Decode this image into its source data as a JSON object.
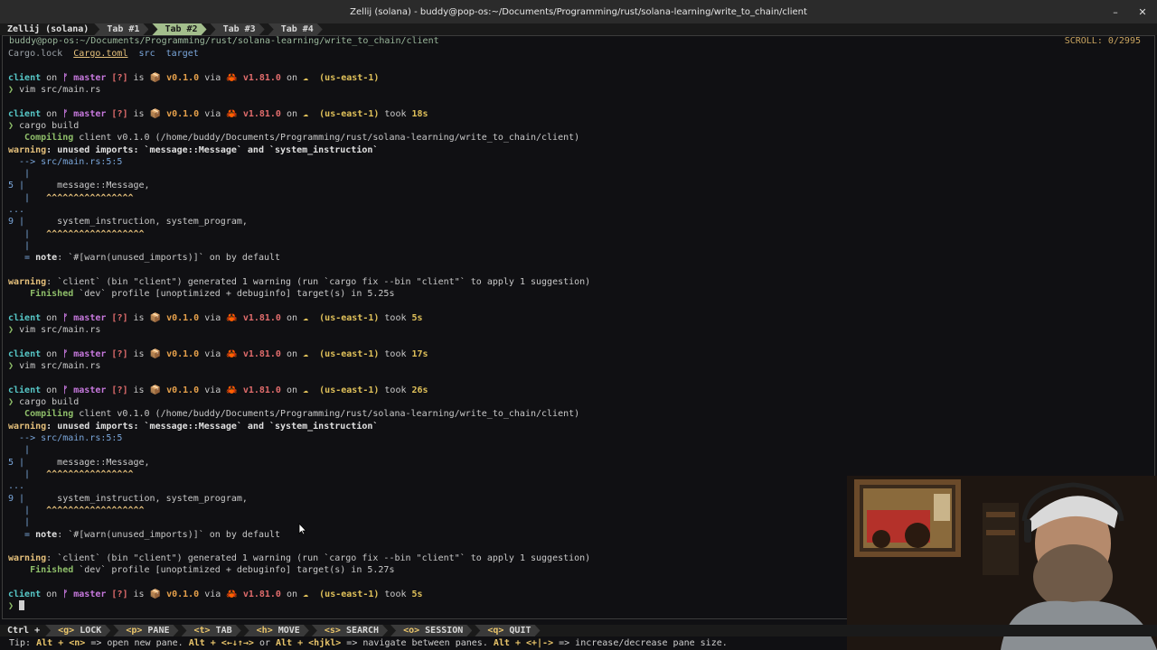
{
  "window": {
    "title": "Zellij (solana) - buddy@pop-os:~/Documents/Programming/rust/solana-learning/write_to_chain/client"
  },
  "tabbar": {
    "session": "Zellij (solana)",
    "tabs": [
      {
        "label": "Tab #1"
      },
      {
        "label": "Tab #2"
      },
      {
        "label": "Tab #3"
      },
      {
        "label": "Tab #4"
      }
    ]
  },
  "pane": {
    "title": "buddy@pop-os:~/Documents/Programming/rust/solana-learning/write_to_chain/client",
    "scroll": "SCROLL:  0/2995"
  },
  "terminal": {
    "ls": {
      "f1": "Cargo.lock",
      "f2": "Cargo.toml",
      "d1": "src",
      "d2": "target"
    },
    "prompt_parts": {
      "dir": "client",
      "on": "on",
      "branch_icon": "ᚠ",
      "branch": "master",
      "status": "[?]",
      "is": "is",
      "pkg_icon": "📦",
      "pkg_ver": "v0.1.0",
      "via": "via",
      "rust_icon": "🦀",
      "rust_ver": "v1.81.0",
      "aws_icon": "☁",
      "region": "(us-east-1)",
      "took": "took"
    },
    "durations": [
      "",
      "18s",
      "5s",
      "17s",
      "26s",
      "5s"
    ],
    "cmd_prefix": "❯",
    "cmds": {
      "vim": "vim src/main.rs",
      "build": "cargo build"
    },
    "compiling": "   Compiling client v0.1.0 (/home/buddy/Documents/Programming/rust/solana-learning/write_to_chain/client)",
    "warning_label": "warning",
    "unused": ": unused imports: `message::Message` and `system_instruction`",
    "arrow_line": "  --> src/main.rs:5:5",
    "pipe": "   |",
    "l5_num": "5 |",
    "l5_code": "      message::Message,",
    "l5_caret": "      ^^^^^^^^^^^^^^^^",
    "dots": "...",
    "l9_num": "9 |",
    "l9_code": "      system_instruction, system_program,",
    "l9_caret": "      ^^^^^^^^^^^^^^^^^^",
    "note_prefix": "   = ",
    "note_label": "note",
    "note_text": ": `#[warn(unused_imports)]` on by default",
    "gen_warning": ": `client` (bin \"client\") generated 1 warning (run `cargo fix --bin \"client\"` to apply 1 suggestion)",
    "finished_label": "    Finished",
    "finished_1": " `dev` profile [unoptimized + debuginfo] target(s) in 5.25s",
    "finished_2": " `dev` profile [unoptimized + debuginfo] target(s) in 5.27s"
  },
  "statusbar": {
    "ctrl": "Ctrl +",
    "keys": [
      {
        "k": "<g>",
        "label": "LOCK"
      },
      {
        "k": "<p>",
        "label": "PANE"
      },
      {
        "k": "<t>",
        "label": "TAB"
      },
      {
        "k": "<h>",
        "label": "MOVE"
      },
      {
        "k": "<s>",
        "label": "SEARCH"
      },
      {
        "k": "<o>",
        "label": "SESSION"
      },
      {
        "k": "<q>",
        "label": "QUIT"
      }
    ]
  },
  "tip": {
    "t1": "Tip: ",
    "k1": "Alt + <n>",
    "t2": " => open new pane. ",
    "k2": "Alt + <←↓↑→>",
    "t3": " or ",
    "k3": "Alt + <hjkl>",
    "t4": " => navigate between panes. ",
    "k4": "Alt + <+|->",
    "t5": " => increase/decrease pane size."
  },
  "colors": {
    "active_tab": "#a3be8c",
    "warning": "#e5c07b",
    "prompt_dir": "#56c6c6",
    "branch": "#c678dd",
    "pkg": "#e0c15a",
    "rust": "#e06c6c"
  }
}
